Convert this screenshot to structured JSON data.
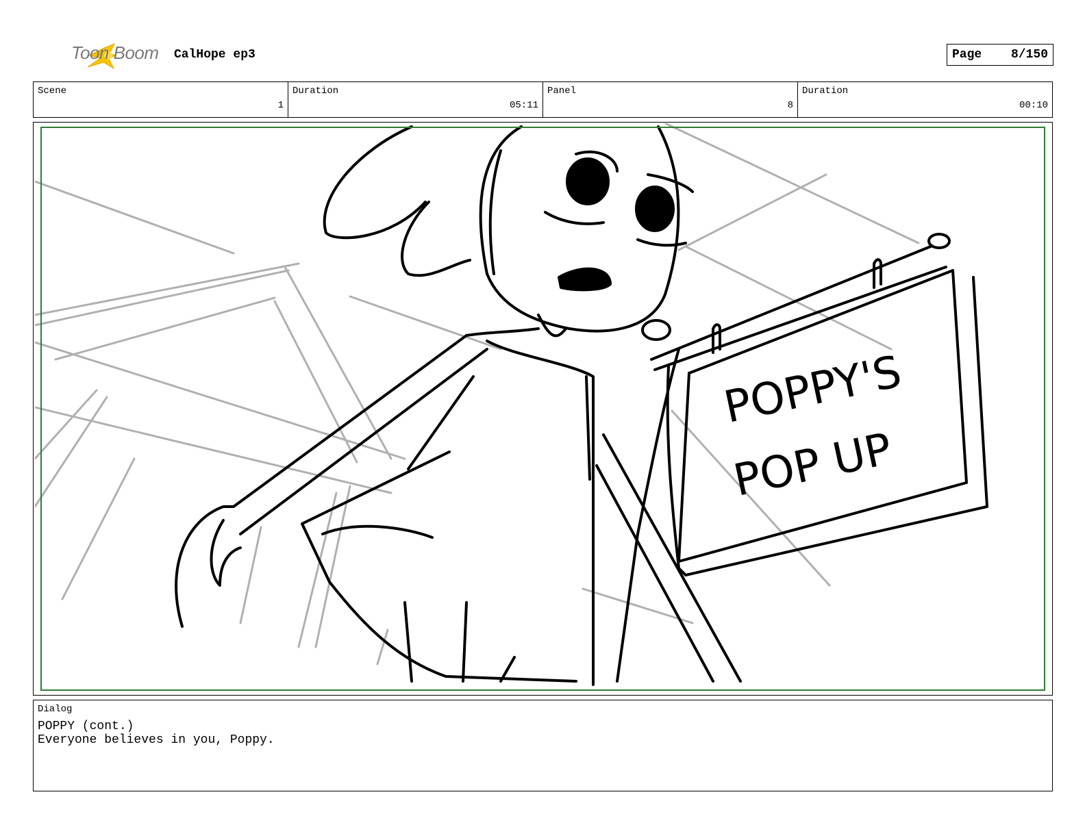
{
  "header": {
    "brand": "Toon Boom",
    "project_title": "CalHope ep3",
    "page_label": "Page",
    "page_value": "8/150"
  },
  "info": {
    "scene_label": "Scene",
    "scene_value": "1",
    "scene_duration_label": "Duration",
    "scene_duration_value": "05:11",
    "panel_label": "Panel",
    "panel_value": "8",
    "panel_duration_label": "Duration",
    "panel_duration_value": "00:10"
  },
  "panel": {
    "sign_line1": "POPPY'S",
    "sign_line2": "POP UP",
    "colors": {
      "safe_frame": "#2e7d32",
      "ink": "#000000",
      "background_ink": "#b0b0b0"
    }
  },
  "dialog": {
    "label": "Dialog",
    "speaker": "POPPY (cont.)",
    "line": "Everyone believes in you, Poppy."
  },
  "logo_colors": {
    "star": "#f5c400"
  }
}
